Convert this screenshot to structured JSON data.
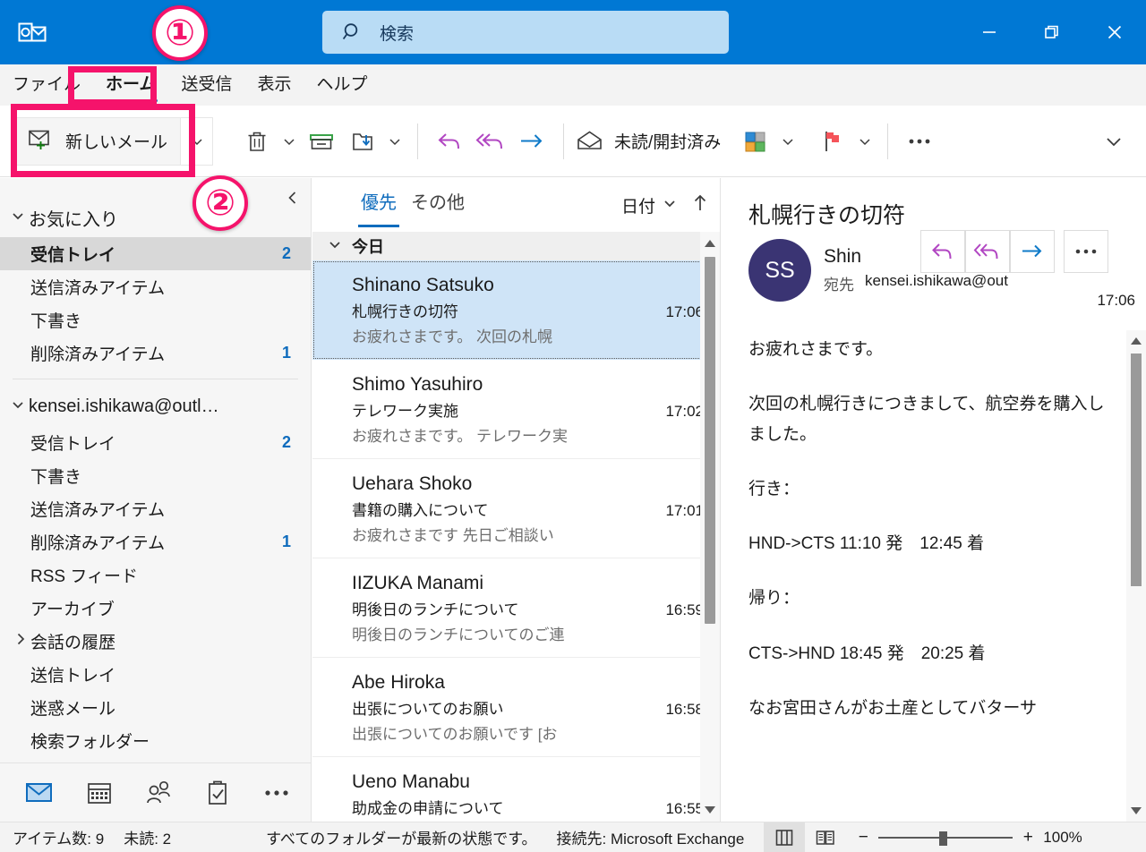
{
  "titlebar": {
    "logo_icon": "outlook-logo-icon",
    "accent_color": "#0078d4",
    "search": {
      "placeholder": "検索",
      "icon": "search-icon",
      "value": ""
    },
    "window_controls": [
      {
        "name": "minimize",
        "icon": "minimize-icon"
      },
      {
        "name": "restore",
        "icon": "restore-icon"
      },
      {
        "name": "close",
        "icon": "close-icon"
      }
    ]
  },
  "menu": {
    "tabs": [
      {
        "label": "ファイル",
        "active": false
      },
      {
        "label": "ホーム",
        "active": true
      },
      {
        "label": "送受信",
        "active": false
      },
      {
        "label": "表示",
        "active": false
      },
      {
        "label": "ヘルプ",
        "active": false
      }
    ]
  },
  "ribbon": {
    "new_mail_label": "新しいメール",
    "new_mail_icon": "new-mail-icon",
    "new_mail_split_icon": "chevron-down-icon",
    "delete_icon": "trash-icon",
    "delete_caret_icon": "chevron-down-icon",
    "archive_icon": "archive-icon",
    "move_icon": "move-to-folder-icon",
    "move_caret_icon": "chevron-down-icon",
    "reply_icon": "reply-icon",
    "reply_all_icon": "reply-all-icon",
    "forward_icon": "forward-icon",
    "unread_icon": "open-envelope-icon",
    "unread_label": "未読/開封済み",
    "categorize_icon": "categorize-icon",
    "categorize_caret_icon": "chevron-down-icon",
    "flag_icon": "flag-icon",
    "flag_caret_icon": "chevron-down-icon",
    "overflow_icon": "ellipsis-icon",
    "expand_icon": "chevron-down-icon"
  },
  "sidebar": {
    "collapse_icon": "chevron-left-icon",
    "groups": [
      {
        "title": "お気に入り",
        "expanded": true,
        "chevron_icon": "chevron-down-icon",
        "items": [
          {
            "label": "受信トレイ",
            "count": "2",
            "selected": true
          },
          {
            "label": "送信済みアイテム",
            "count": "",
            "selected": false
          },
          {
            "label": "下書き",
            "count": "",
            "selected": false
          },
          {
            "label": "削除済みアイテム",
            "count": "1",
            "selected": false
          }
        ]
      },
      {
        "title": "kensei.ishikawa@outl…",
        "expanded": true,
        "chevron_icon": "chevron-down-icon",
        "items": [
          {
            "label": "受信トレイ",
            "count": "2",
            "selected": false
          },
          {
            "label": "下書き",
            "count": "",
            "selected": false
          },
          {
            "label": "送信済みアイテム",
            "count": "",
            "selected": false
          },
          {
            "label": "削除済みアイテム",
            "count": "1",
            "selected": false
          },
          {
            "label": "RSS フィード",
            "count": "",
            "selected": false
          },
          {
            "label": "アーカイブ",
            "count": "",
            "selected": false
          },
          {
            "label": "会話の履歴",
            "count": "",
            "selected": false,
            "chevron_icon": "chevron-right-icon"
          },
          {
            "label": "送信トレイ",
            "count": "",
            "selected": false
          },
          {
            "label": "迷惑メール",
            "count": "",
            "selected": false
          },
          {
            "label": "検索フォルダー",
            "count": "",
            "selected": false
          }
        ]
      }
    ],
    "nav": [
      {
        "name": "mail-icon",
        "active": true
      },
      {
        "name": "calendar-icon",
        "active": false
      },
      {
        "name": "people-icon",
        "active": false
      },
      {
        "name": "tasks-icon",
        "active": false
      },
      {
        "name": "more-apps-icon",
        "active": false
      }
    ]
  },
  "message_list": {
    "pivots": [
      {
        "label": "優先",
        "active": true
      },
      {
        "label": "その他",
        "active": false
      }
    ],
    "sort_label": "日付",
    "sort_caret_icon": "chevron-down-icon",
    "sort_direction_icon": "arrow-up-icon",
    "group_label": "今日",
    "group_chevron_icon": "chevron-down-icon",
    "rows": [
      {
        "sender": "Shinano Satsuko",
        "subject": "札幌行きの切符",
        "time": "17:06",
        "preview": "お疲れさまです。 次回の札幌",
        "selected": true
      },
      {
        "sender": "Shimo Yasuhiro",
        "subject": "テレワーク実施",
        "time": "17:02",
        "preview": "お疲れさまです。 テレワーク実",
        "selected": false
      },
      {
        "sender": "Uehara Shoko",
        "subject": "書籍の購入について",
        "time": "17:01",
        "preview": "お疲れさまです 先日ご相談い",
        "selected": false
      },
      {
        "sender": "IIZUKA Manami",
        "subject": "明後日のランチについて",
        "time": "16:59",
        "preview": "明後日のランチについてのご連",
        "selected": false
      },
      {
        "sender": "Abe Hiroka",
        "subject": "出張についてのお願い",
        "time": "16:58",
        "preview": "出張についてのお願いです [お",
        "selected": false
      },
      {
        "sender": "Ueno Manabu",
        "subject": "助成金の申請について",
        "time": "16:55",
        "preview": "",
        "selected": false
      }
    ],
    "scrollbar": {
      "up_icon": "scroll-up-arrow-icon",
      "down_icon": "scroll-down-arrow-icon"
    }
  },
  "reading_pane": {
    "subject": "札幌行きの切符",
    "avatar_initials": "SS",
    "avatar_color": "#3a3473",
    "sender_name": "Shin",
    "to_label": "宛先",
    "to_value": "kensei.ishikawa@out",
    "time": "17:06",
    "actions": [
      {
        "name": "reply-button",
        "icon": "reply-icon"
      },
      {
        "name": "reply-all-button",
        "icon": "reply-all-icon"
      },
      {
        "name": "forward-button",
        "icon": "forward-icon"
      },
      {
        "name": "more-actions-button",
        "icon": "ellipsis-icon"
      }
    ],
    "body_paragraphs": [
      "お疲れさまです。",
      "次回の札幌行きにつきまして、航空券を購入しました。",
      "行き：",
      "HND->CTS 11:10 発　12:45 着",
      "帰り：",
      "CTS->HND 18:45 発　20:25 着",
      "なお宮田さんがお土産としてバターサ"
    ],
    "scrollbar": {
      "up_icon": "scroll-up-arrow-icon",
      "down_icon": "scroll-down-arrow-icon"
    }
  },
  "statusbar": {
    "items_label": "アイテム数: 9",
    "unread_label": "未読: 2",
    "sync_label": "すべてのフォルダーが最新の状態です。",
    "connection_label": "接続先: Microsoft Exchange",
    "view_buttons": [
      {
        "name": "normal-view-button",
        "icon": "reading-pane-layout-icon",
        "active": true
      },
      {
        "name": "reading-view-button",
        "icon": "book-view-icon",
        "active": false
      }
    ],
    "zoom_out_label": "−",
    "zoom_in_label": "+",
    "zoom_level": "100%"
  },
  "annotations": [
    {
      "label": "①",
      "target": "home-tab"
    },
    {
      "label": "②",
      "target": "new-mail-button"
    }
  ]
}
